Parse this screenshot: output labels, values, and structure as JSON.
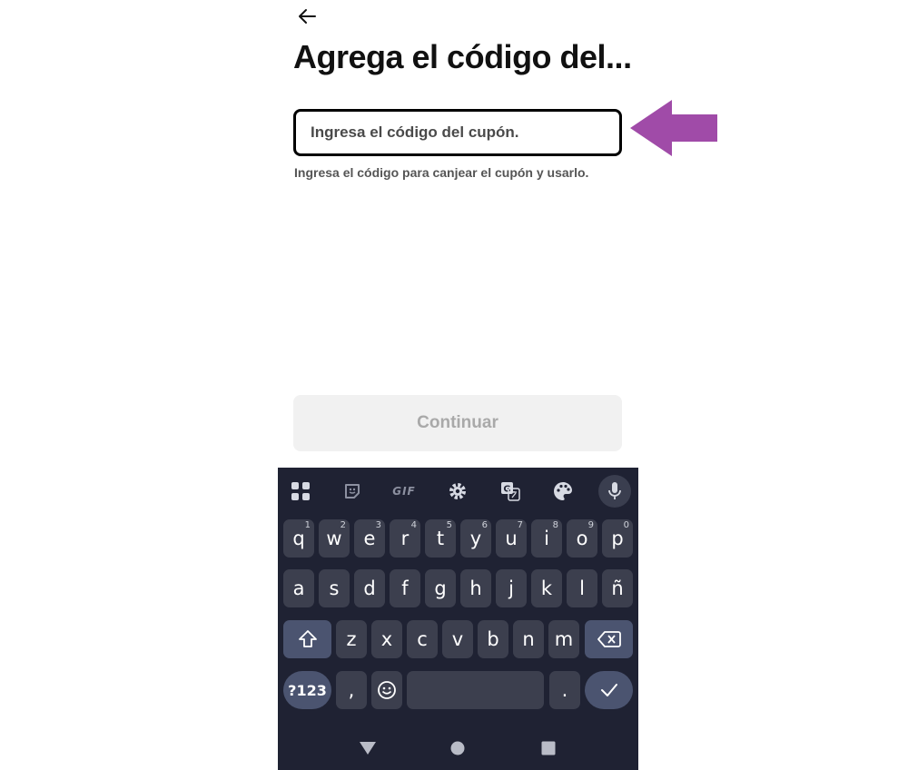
{
  "header": {
    "back_icon": "arrow-left-icon",
    "title": "Agrega el código del..."
  },
  "coupon": {
    "placeholder": "Ingresa el código del cupón.",
    "value": "",
    "hint": "Ingresa el código para canjear el cupón y usarlo."
  },
  "annotation": {
    "arrow_color": "#A04BA8",
    "arrow_icon": "left-arrow-pointer"
  },
  "actions": {
    "continue_label": "Continuar"
  },
  "keyboard": {
    "toolbar": {
      "apps_icon": "grid-icon",
      "sticker_icon": "sticker-icon",
      "gif_label": "GIF",
      "settings_icon": "gear-icon",
      "translate_icon": "translate-icon",
      "theme_icon": "palette-icon",
      "mic_icon": "microphone-icon"
    },
    "rows": {
      "row1": [
        {
          "label": "q",
          "hint": "1"
        },
        {
          "label": "w",
          "hint": "2"
        },
        {
          "label": "e",
          "hint": "3"
        },
        {
          "label": "r",
          "hint": "4"
        },
        {
          "label": "t",
          "hint": "5"
        },
        {
          "label": "y",
          "hint": "6"
        },
        {
          "label": "u",
          "hint": "7"
        },
        {
          "label": "i",
          "hint": "8"
        },
        {
          "label": "o",
          "hint": "9"
        },
        {
          "label": "p",
          "hint": "0"
        }
      ],
      "row2": [
        "a",
        "s",
        "d",
        "f",
        "g",
        "h",
        "j",
        "k",
        "l",
        "ñ"
      ],
      "row3": [
        "z",
        "x",
        "c",
        "v",
        "b",
        "n",
        "m"
      ],
      "row4": {
        "symbols": "?123",
        "comma": ",",
        "emoji_icon": "emoji-icon",
        "period": ".",
        "enter_icon": "checkmark-icon"
      },
      "shift_icon": "shift-icon",
      "backspace_icon": "backspace-icon"
    },
    "colors": {
      "background": "#1F2233",
      "key": "#3C3F4E",
      "function_key": "#4B5470"
    }
  },
  "system_nav": {
    "back_icon": "triangle-back-icon",
    "home_icon": "circle-home-icon",
    "recents_icon": "square-recents-icon"
  }
}
